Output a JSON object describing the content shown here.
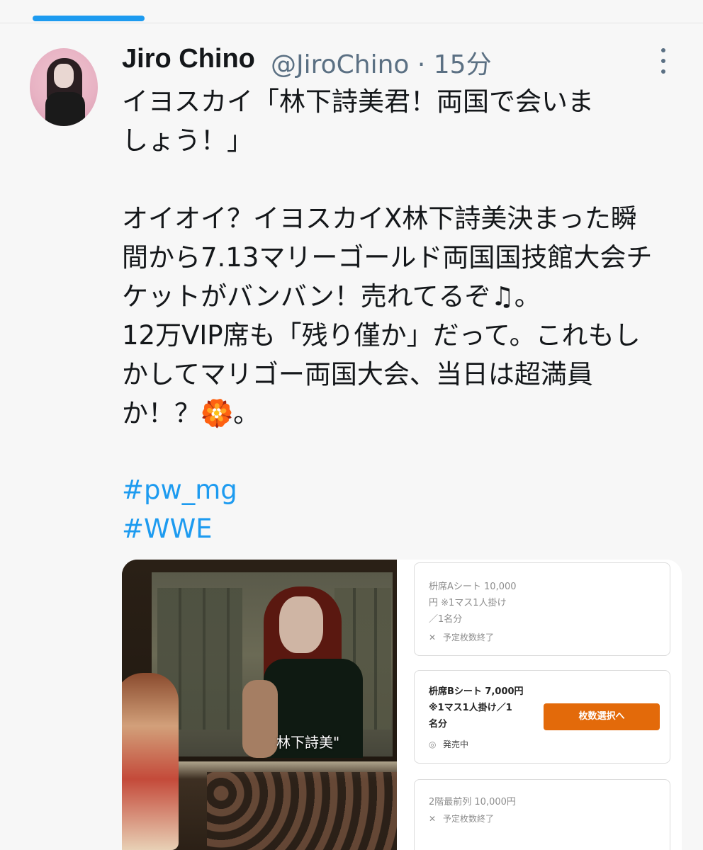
{
  "tweet": {
    "author_name": "Jiro Chino",
    "author_meta": "@JiroChino · 15分",
    "text": "イヨスカイ「林下詩美君！両国で会いま\nしょう！」\n\nオイオイ？イヨスカイX林下詩美決まった瞬\n間から7.13マリーゴールド両国国技館大会チ\nケットがバンバン！売れてるぞ♫。\n12万VIP席も「残り僅か」だって。これもし\nかしてマリゴー両国大会、当日は超満員\nか！？🏵️。",
    "hashtags": [
      "#pw_mg",
      "#WWE"
    ]
  },
  "media": {
    "photo_caption": "林下詩美\"",
    "tickets": [
      {
        "name": "枡席Aシート 10,000\n円 ※1マス1人掛け\n／1名分",
        "status": "予定枚数終了",
        "status_icon": "x-mark-icon"
      },
      {
        "name": "枡席Bシート 7,000円\n※1マス1人掛け／1\n名分",
        "status": "発売中",
        "status_icon": "circle-icon",
        "button": "枚数選択へ"
      },
      {
        "name": "2階最前列 10,000円",
        "status": "予定枚数終了",
        "status_icon": "x-mark-icon"
      }
    ]
  },
  "colors": {
    "accent": "#1d9bf0",
    "button": "#e36a0a",
    "muted_text": "#5b7083"
  }
}
